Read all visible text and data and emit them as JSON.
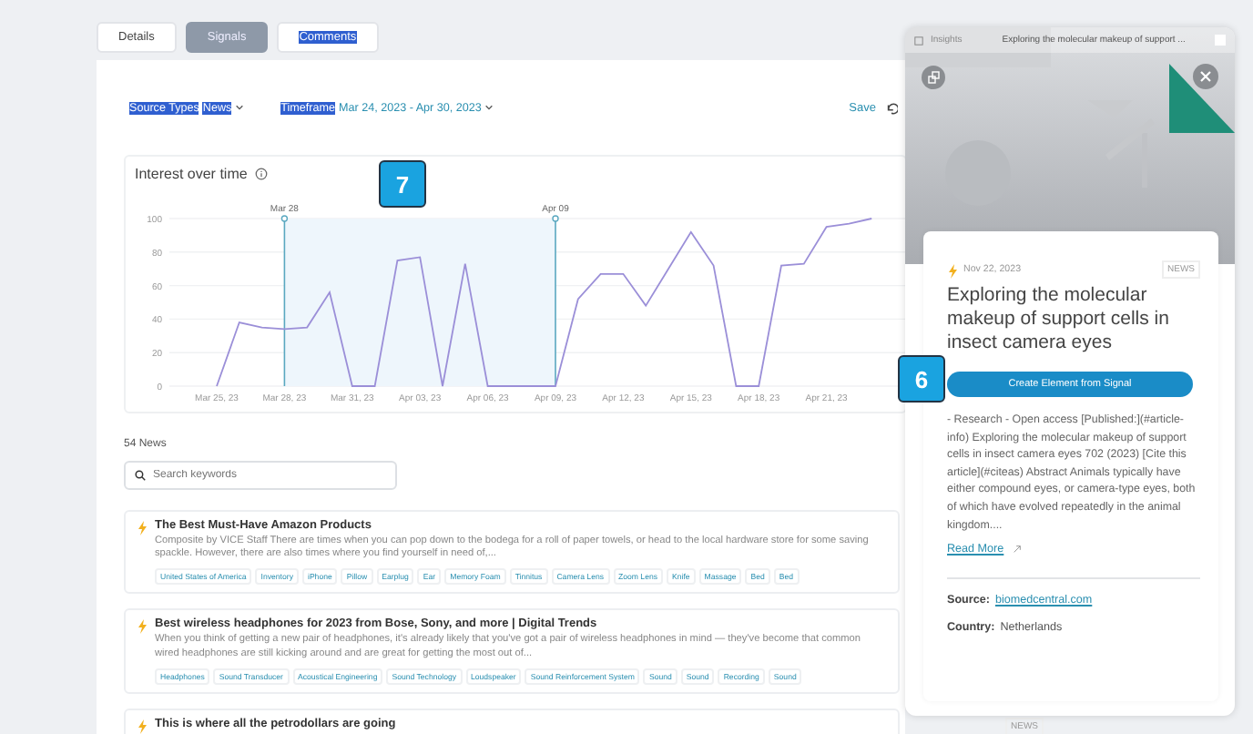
{
  "tabs": [
    {
      "label": "Details",
      "selected": false,
      "highlighted": false
    },
    {
      "label": "Signals",
      "selected": true,
      "highlighted": false
    },
    {
      "label": "Comments",
      "selected": false,
      "highlighted": true
    }
  ],
  "filters": [
    {
      "label": "Source Types",
      "value": "News",
      "label_highlighted": true,
      "value_highlighted": true
    },
    {
      "label": "Timeframe",
      "value": "Mar 24, 2023 - Apr 30, 2023",
      "label_highlighted": true,
      "value_highlighted": false
    }
  ],
  "save_label": "Save",
  "interest_chart": {
    "title": "Interest over time",
    "chart_data": {
      "type": "line",
      "categories": [
        "Mar 25, 23",
        null,
        null,
        "Mar 28, 23",
        null,
        null,
        "Mar 31, 23",
        null,
        null,
        "Apr 03, 23",
        null,
        null,
        "Apr 06, 23",
        null,
        null,
        "Apr 09, 23",
        null,
        null,
        "Apr 12, 23",
        null,
        null,
        "Apr 15, 23",
        null,
        null,
        "Apr 18, 23",
        null,
        null,
        "Apr 21, 23",
        null,
        null
      ],
      "grid": true,
      "series": [
        {
          "color": "#9b8fd8",
          "values": [
            0,
            38,
            35,
            34,
            35,
            56,
            0,
            0,
            75,
            77,
            0,
            73,
            0,
            0,
            0,
            0,
            52,
            67,
            67,
            48,
            70,
            92,
            72,
            0,
            0,
            72,
            73,
            95,
            97,
            100
          ]
        }
      ],
      "ylim": [
        0,
        100
      ],
      "yticks": [
        0,
        20,
        40,
        60,
        80,
        100
      ],
      "bands": [
        {
          "from": "Mar 28",
          "to": "Apr 09",
          "color": "#eef6fc"
        }
      ]
    }
  },
  "news_count": "54 News",
  "search": {
    "placeholder": "Search keywords"
  },
  "news": [
    {
      "title": "The Best Must-Have Amazon Products",
      "description": "Composite by VICE Staff There are times when you can pop down to the bodega for a roll of paper towels, or head to the local hardware store for some saving spackle. However, there are also times where you find yourself in need of,...",
      "tags": [
        "United States of America",
        "Inventory",
        "iPhone",
        "Pillow",
        "Earplug",
        "Ear",
        "Memory Foam",
        "Tinnitus",
        "Camera Lens",
        "Zoom Lens",
        "Knife",
        "Massage",
        "Bed",
        "Bed"
      ]
    },
    {
      "title": "Best wireless headphones for 2023 from Bose, Sony, and more | Digital Trends",
      "description": "When you think of getting a new pair of headphones, it's already likely that you've got a pair of wireless headphones in mind — they've become that common wired headphones are still kicking around and are great for getting the most out of...",
      "tags": [
        "Headphones",
        "Sound Transducer",
        "Acoustical Engineering",
        "Sound Technology",
        "Loudspeaker",
        "Sound Reinforcement System",
        "Sound",
        "Sound",
        "Recording",
        "Sound"
      ]
    },
    {
      "title": "This is where all the petrodollars are going",
      "source_type": "NEWS"
    }
  ],
  "step_badges": [
    {
      "label": "7"
    },
    {
      "label": "6"
    }
  ],
  "detail_panel": {
    "section": "Insights",
    "header_title": "Exploring the molecular makeup of support ...",
    "date": "Nov 22, 2023",
    "source_type": "NEWS",
    "title": "Exploring the molecular makeup of support cells in insect camera eyes",
    "action": "Create Element from Signal",
    "body": "- Research - Open access [Published:](#article-info) Exploring the molecular makeup of support cells in insect camera eyes 702 (2023) [Cite this article](#citeas) Abstract Animals typically have either compound eyes, or camera-type eyes, both of which have evolved repeatedly in the animal kingdom....",
    "read_more": "Read More",
    "source_label": "Source:",
    "source": "biomedcentral.com",
    "country_label": "Country:",
    "country": "Netherlands"
  }
}
